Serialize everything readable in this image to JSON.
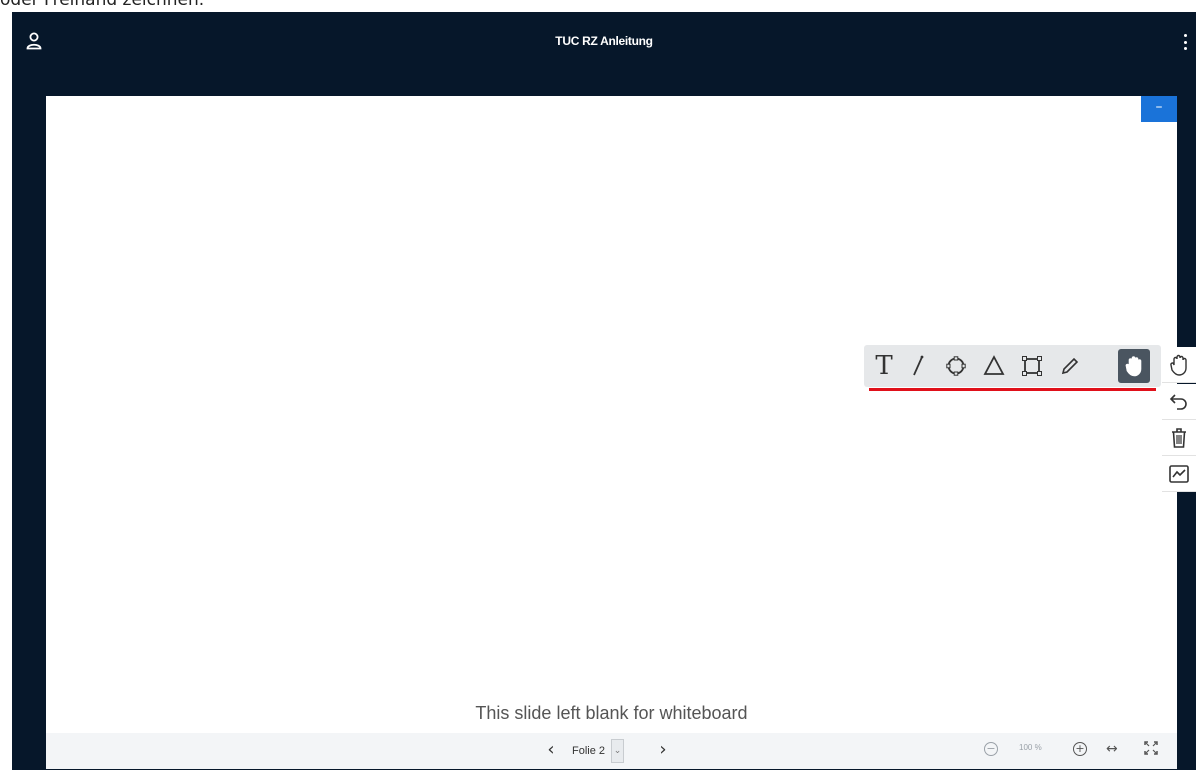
{
  "caption": "oder Freihand zeichnen.",
  "header": {
    "title": "TUC RZ Anleitung",
    "user_icon": "user-icon",
    "menu_icon": "kebab-menu-icon"
  },
  "slide": {
    "blank_text": "This slide left blank for whiteboard",
    "minimize_label": "–"
  },
  "bottom_bar": {
    "prev_label": "‹",
    "next_label": "›",
    "slide_label": "Folie 2",
    "dropdown_label": "⌄",
    "zoom_level": "100 %",
    "zoom_out_label": "−",
    "zoom_in_label": "+",
    "fit_width_label": "↔"
  },
  "toolbar": {
    "tools": [
      "text-tool",
      "line-tool",
      "ellipse-tool",
      "triangle-tool",
      "rectangle-tool",
      "pencil-tool",
      "pan-tool"
    ],
    "active_tool": "pan-tool",
    "side_tools": [
      "pan-tool",
      "undo-tool",
      "clear-tool",
      "multi-user-tool"
    ]
  },
  "colors": {
    "app_background": "#06172a",
    "accent": "#1a73d9",
    "highlight_underline": "#e0101a",
    "active_tool_bg": "#4a5560"
  }
}
